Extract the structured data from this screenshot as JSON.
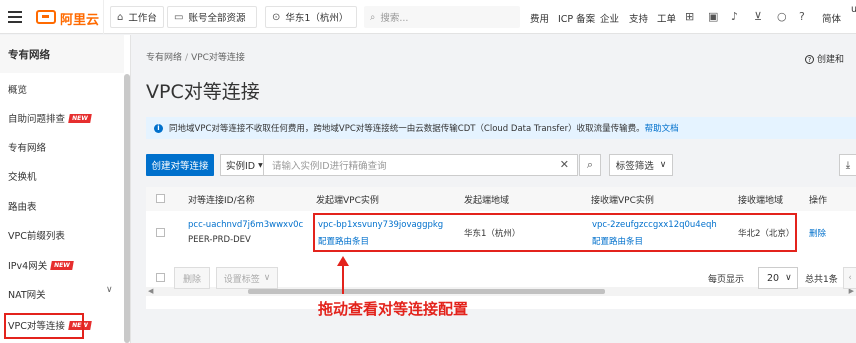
{
  "topbar": {
    "logo_text": "阿里云",
    "workbench": "工作台",
    "resource": "账号全部资源",
    "region": "华东1（杭州）",
    "search_placeholder": "搜索...",
    "nav": [
      "费用",
      "ICP 备案",
      "企业",
      "支持",
      "工单"
    ],
    "lang": "简体",
    "user_initial": "u"
  },
  "sidebar": {
    "title": "专有网络",
    "items": [
      {
        "label": "概览"
      },
      {
        "label": "自助问题排查",
        "badge": "NEW"
      },
      {
        "label": "专有网络"
      },
      {
        "label": "交换机"
      },
      {
        "label": "路由表"
      },
      {
        "label": "VPC前缀列表"
      },
      {
        "label": "IPv4网关",
        "badge": "NEW"
      },
      {
        "label": "NAT网关"
      },
      {
        "label": "VPC对等连接",
        "badge": "NEW"
      }
    ]
  },
  "main": {
    "breadcrumb": [
      "专有网络",
      "VPC对等连接"
    ],
    "create_doc": "创建和",
    "title": "VPC对等连接",
    "info_text": "同地域VPC对等连接不收取任何费用，跨地域VPC对等连接统一由云数据传输CDT（Cloud Data Transfer）收取流量传输费。",
    "info_link": "帮助文档",
    "create_button": "创建对等连接",
    "select_label": "实例ID",
    "search_placeholder": "请输入实例ID进行精确查询",
    "tag_filter": "标签筛选"
  },
  "table": {
    "headers": [
      "对等连接ID/名称",
      "发起端VPC实例",
      "发起端地域",
      "接收端VPC实例",
      "接收端地域",
      "操作"
    ],
    "rows": [
      {
        "id": "pcc-uachnvd7j6m3wwxv0c",
        "name": "PEER-PRD-DEV",
        "src_vpc": "vpc-bp1xsvuny739jovaggpkg",
        "src_route": "配置路由条目",
        "src_region": "华东1（杭州）",
        "dst_vpc": "vpc-2zeufgzccgxx12q0u4eqh",
        "dst_route": "配置路由条目",
        "dst_region": "华北2（北京）",
        "action": "删除"
      }
    ]
  },
  "footer": {
    "delete": "删除",
    "set_tag": "设置标签",
    "per_page_label": "每页显示",
    "per_page": "20",
    "total": "总共1条"
  },
  "annotation": "拖动查看对等连接配置"
}
